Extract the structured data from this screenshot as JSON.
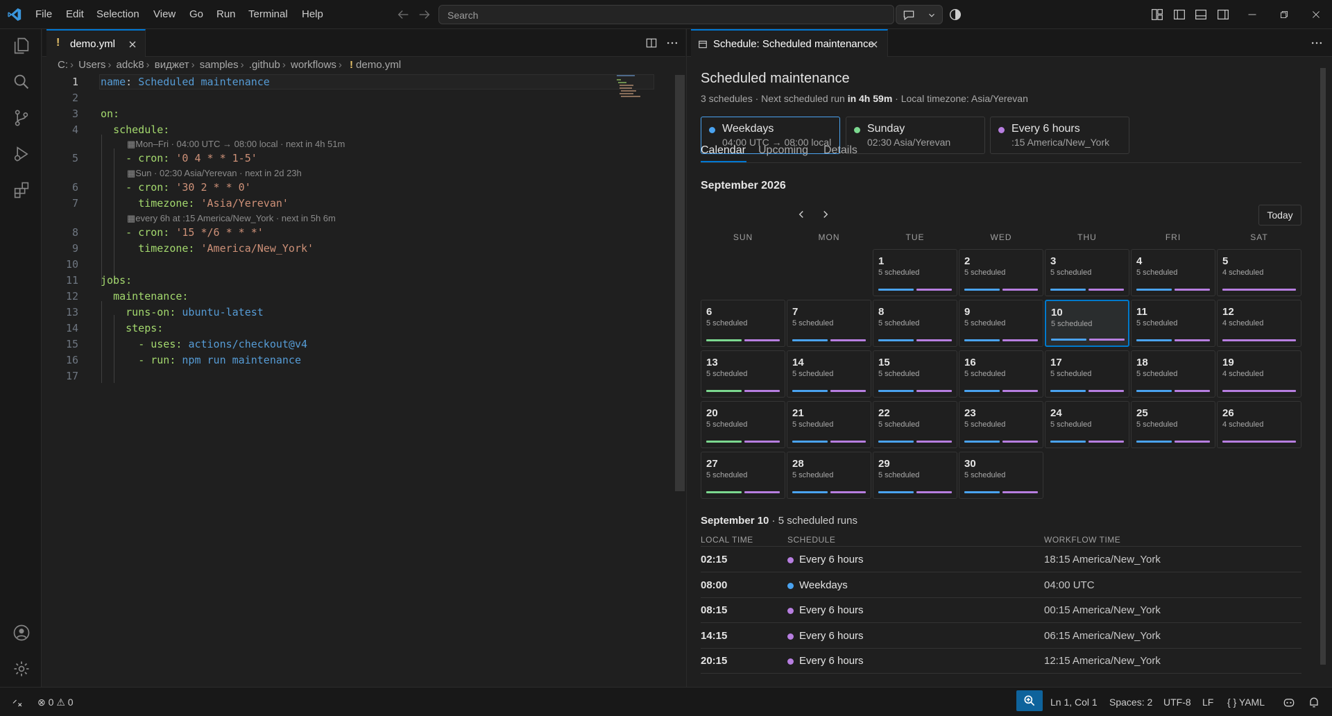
{
  "titlebar": {
    "menu": [
      "File",
      "Edit",
      "Selection",
      "View",
      "Go",
      "Run",
      "Terminal",
      "Help"
    ],
    "search_placeholder": "Search"
  },
  "editor": {
    "tab_label": "demo.yml",
    "breadcrumb": [
      "C:",
      "Users",
      "adck8",
      "виджет",
      "samples",
      ".github",
      "workflows",
      "demo.yml"
    ],
    "line_numbers": [
      "1",
      "2",
      "3",
      "4",
      "5",
      "6",
      "7",
      "8",
      "9",
      "10",
      "11",
      "12",
      "13",
      "14",
      "15",
      "16",
      "17"
    ],
    "hints": {
      "h1": "Mon–Fri · 04:00 UTC → 08:00 local · next in 4h 51m",
      "h2": "Sun · 02:30 Asia/Yerevan · next in 2d 23h",
      "h3": "every 6h at :15 America/New_York · next in 5h 6m"
    },
    "code": {
      "l1k": "name",
      "l1v": "Scheduled maintenance",
      "l3": "on:",
      "l4": "schedule:",
      "l5k": "- cron:",
      "l5v": "'0 4 * * 1-5'",
      "l6k": "- cron:",
      "l6v": "'30 2 * * 0'",
      "l7k": "timezone:",
      "l7v": "'Asia/Yerevan'",
      "l8k": "- cron:",
      "l8v": "'15 */6 * * *'",
      "l9k": "timezone:",
      "l9v": "'America/New_York'",
      "l11": "jobs:",
      "l12": "maintenance:",
      "l13k": "runs-on:",
      "l13v": "ubuntu-latest",
      "l14": "steps:",
      "l15k": "- uses:",
      "l15v": "actions/checkout@v4",
      "l16k": "- run:",
      "l16v": "npm run maintenance"
    }
  },
  "panel": {
    "tab_label": "Schedule: Scheduled maintenance",
    "title": "Scheduled maintenance",
    "subtitle_a": "3 schedules · Next scheduled run ",
    "subtitle_b": "in 4h 59m",
    "subtitle_c": " · Local timezone: Asia/Yerevan",
    "schedules": [
      {
        "name": "Weekdays",
        "detail": "04:00 UTC → 08:00 local",
        "color": "#4aa3f0"
      },
      {
        "name": "Sunday",
        "detail": "02:30 Asia/Yerevan",
        "color": "#7bd88f"
      },
      {
        "name": "Every 6 hours",
        "detail": ":15 America/New_York",
        "color": "#b77ee0"
      }
    ],
    "tabs": [
      "Calendar",
      "Upcoming",
      "Details"
    ],
    "month": "September 2026",
    "today_label": "Today",
    "weekdays": [
      "SUN",
      "MON",
      "TUE",
      "WED",
      "THU",
      "FRI",
      "SAT"
    ],
    "selected_day": "10",
    "day_summary_a": "September 10",
    "day_summary_b": " · 5 scheduled runs",
    "table_headers": [
      "LOCAL TIME",
      "SCHEDULE",
      "WORKFLOW TIME"
    ],
    "runs": [
      {
        "time": "02:15",
        "schedule": "Every 6 hours",
        "wf": "18:15 America/New_York",
        "color": "#b77ee0"
      },
      {
        "time": "08:00",
        "schedule": "Weekdays",
        "wf": "04:00 UTC",
        "color": "#4aa3f0"
      },
      {
        "time": "08:15",
        "schedule": "Every 6 hours",
        "wf": "00:15 America/New_York",
        "color": "#b77ee0"
      },
      {
        "time": "14:15",
        "schedule": "Every 6 hours",
        "wf": "06:15 America/New_York",
        "color": "#b77ee0"
      },
      {
        "time": "20:15",
        "schedule": "Every 6 hours",
        "wf": "12:15 America/New_York",
        "color": "#b77ee0"
      }
    ]
  },
  "calendar_days": [
    {
      "d": "1",
      "count": "5 scheduled",
      "bars": [
        "blue",
        "purple"
      ]
    },
    {
      "d": "2",
      "count": "5 scheduled",
      "bars": [
        "blue",
        "purple"
      ]
    },
    {
      "d": "3",
      "count": "5 scheduled",
      "bars": [
        "blue",
        "purple"
      ]
    },
    {
      "d": "4",
      "count": "5 scheduled",
      "bars": [
        "blue",
        "purple"
      ]
    },
    {
      "d": "5",
      "count": "4 scheduled",
      "bars": [
        "purple"
      ]
    },
    {
      "d": "6",
      "count": "5 scheduled",
      "bars": [
        "green",
        "purple"
      ]
    },
    {
      "d": "7",
      "count": "5 scheduled",
      "bars": [
        "blue",
        "purple"
      ]
    },
    {
      "d": "8",
      "count": "5 scheduled",
      "bars": [
        "blue",
        "purple"
      ]
    },
    {
      "d": "9",
      "count": "5 scheduled",
      "bars": [
        "blue",
        "purple"
      ]
    },
    {
      "d": "10",
      "count": "5 scheduled",
      "bars": [
        "blue",
        "purple"
      ]
    },
    {
      "d": "11",
      "count": "5 scheduled",
      "bars": [
        "blue",
        "purple"
      ]
    },
    {
      "d": "12",
      "count": "4 scheduled",
      "bars": [
        "purple"
      ]
    },
    {
      "d": "13",
      "count": "5 scheduled",
      "bars": [
        "green",
        "purple"
      ]
    },
    {
      "d": "14",
      "count": "5 scheduled",
      "bars": [
        "blue",
        "purple"
      ]
    },
    {
      "d": "15",
      "count": "5 scheduled",
      "bars": [
        "blue",
        "purple"
      ]
    },
    {
      "d": "16",
      "count": "5 scheduled",
      "bars": [
        "blue",
        "purple"
      ]
    },
    {
      "d": "17",
      "count": "5 scheduled",
      "bars": [
        "blue",
        "purple"
      ]
    },
    {
      "d": "18",
      "count": "5 scheduled",
      "bars": [
        "blue",
        "purple"
      ]
    },
    {
      "d": "19",
      "count": "4 scheduled",
      "bars": [
        "purple"
      ]
    },
    {
      "d": "20",
      "count": "5 scheduled",
      "bars": [
        "green",
        "purple"
      ]
    },
    {
      "d": "21",
      "count": "5 scheduled",
      "bars": [
        "blue",
        "purple"
      ]
    },
    {
      "d": "22",
      "count": "5 scheduled",
      "bars": [
        "blue",
        "purple"
      ]
    },
    {
      "d": "23",
      "count": "5 scheduled",
      "bars": [
        "blue",
        "purple"
      ]
    },
    {
      "d": "24",
      "count": "5 scheduled",
      "bars": [
        "blue",
        "purple"
      ]
    },
    {
      "d": "25",
      "count": "5 scheduled",
      "bars": [
        "blue",
        "purple"
      ]
    },
    {
      "d": "26",
      "count": "4 scheduled",
      "bars": [
        "purple"
      ]
    },
    {
      "d": "27",
      "count": "5 scheduled",
      "bars": [
        "green",
        "purple"
      ]
    },
    {
      "d": "28",
      "count": "5 scheduled",
      "bars": [
        "blue",
        "purple"
      ]
    },
    {
      "d": "29",
      "count": "5 scheduled",
      "bars": [
        "blue",
        "purple"
      ]
    },
    {
      "d": "30",
      "count": "5 scheduled",
      "bars": [
        "blue",
        "purple"
      ]
    }
  ],
  "statusbar": {
    "errors": "0",
    "warnings": "0",
    "position": "Ln 1, Col 1",
    "spaces": "Spaces: 2",
    "encoding": "UTF-8",
    "eol": "LF",
    "language": "YAML"
  }
}
